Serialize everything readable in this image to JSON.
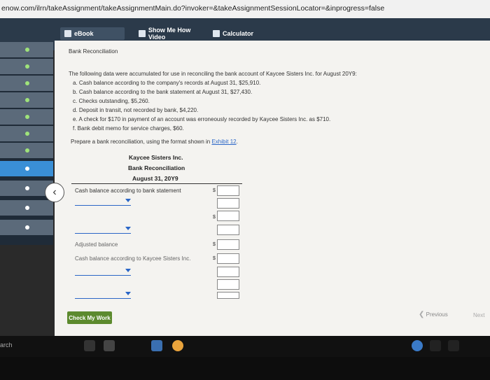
{
  "browser": {
    "url": "enow.com/ilrn/takeAssignment/takeAssignmentMain.do?invoker=&takeAssignmentSessionLocator=&inprogress=false"
  },
  "toolbar": {
    "ebook": "eBook",
    "video": "Show Me How Video",
    "calc": "Calculator"
  },
  "content": {
    "title": "Bank Reconciliation",
    "intro": "The following data were accumulated for use in reconciling the bank account of Kaycee Sisters Inc. for August 20Y9:",
    "items": [
      "a. Cash balance according to the company's records at August 31, $25,910.",
      "b. Cash balance according to the bank statement at August 31, $27,430.",
      "c. Checks outstanding, $5,260.",
      "d. Deposit in transit, not recorded by bank, $4,220.",
      "e. A check for $170 in payment of an account was erroneously recorded by Kaycee Sisters Inc. as $710.",
      "f. Bank debit memo for service charges, $60."
    ],
    "prepare_prefix": "Prepare a bank reconciliation, using the format shown in ",
    "prepare_link": "Exhibit 12",
    "prepare_suffix": "."
  },
  "table": {
    "company": "Kaycee Sisters Inc.",
    "title": "Bank Reconciliation",
    "date": "August 31, 20Y9",
    "row_bank": "Cash balance according to bank statement",
    "row_adjusted": "Adjusted balance",
    "row_company": "Cash balance according to Kaycee Sisters Inc.",
    "dollar": "$"
  },
  "nav": {
    "check": "Check My Work",
    "previous": "Previous",
    "next": "Next"
  },
  "taskbar": {
    "search": "arch"
  }
}
